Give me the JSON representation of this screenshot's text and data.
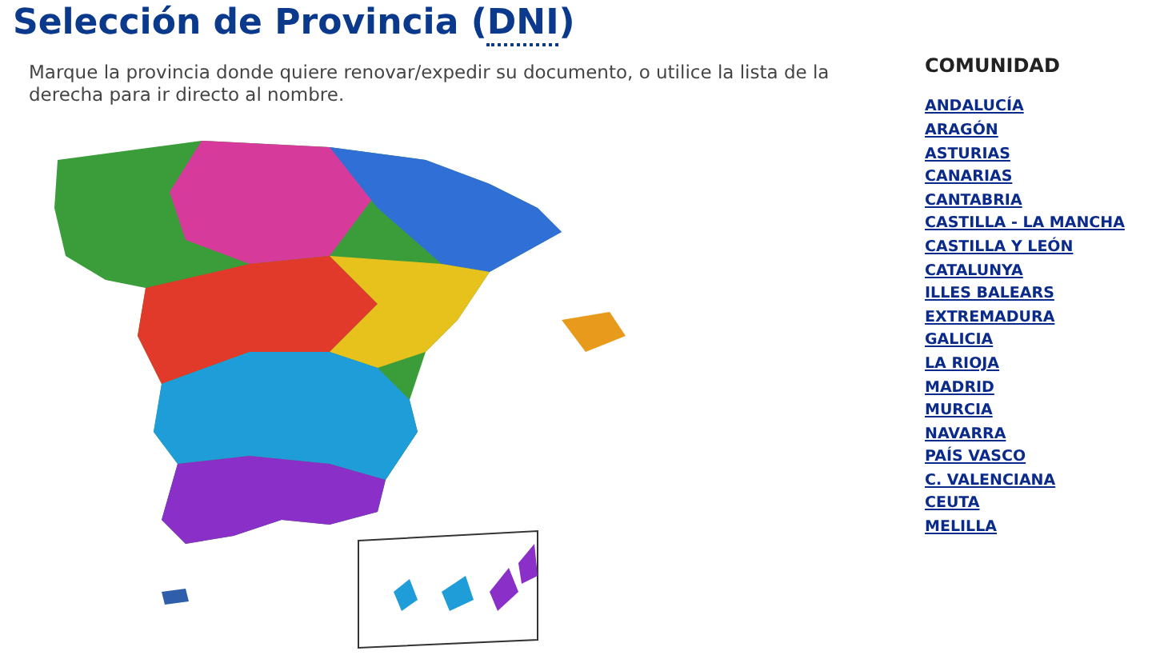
{
  "title": {
    "text": "Selección de Provincia (",
    "abbr": "DNI",
    "close": ")"
  },
  "intro": "Marque la provincia donde quiere renovar/expedir su documento, o utilice la lista de la derecha para ir directo al nombre.",
  "sidebar": {
    "heading": "COMUNIDAD",
    "items": [
      "ANDALUCÍA",
      "ARAGÓN",
      "ASTURIAS",
      "CANARIAS",
      "CANTABRIA",
      "CASTILLA - LA MANCHA",
      "CASTILLA Y LEÓN",
      "CATALUNYA",
      "ILLES BALEARS",
      "EXTREMADURA",
      "GALICIA",
      "LA RIOJA",
      "MADRID",
      "MURCIA",
      "NAVARRA",
      "PAÍS VASCO",
      "C. VALENCIANA",
      "CEUTA",
      "MELILLA"
    ]
  }
}
